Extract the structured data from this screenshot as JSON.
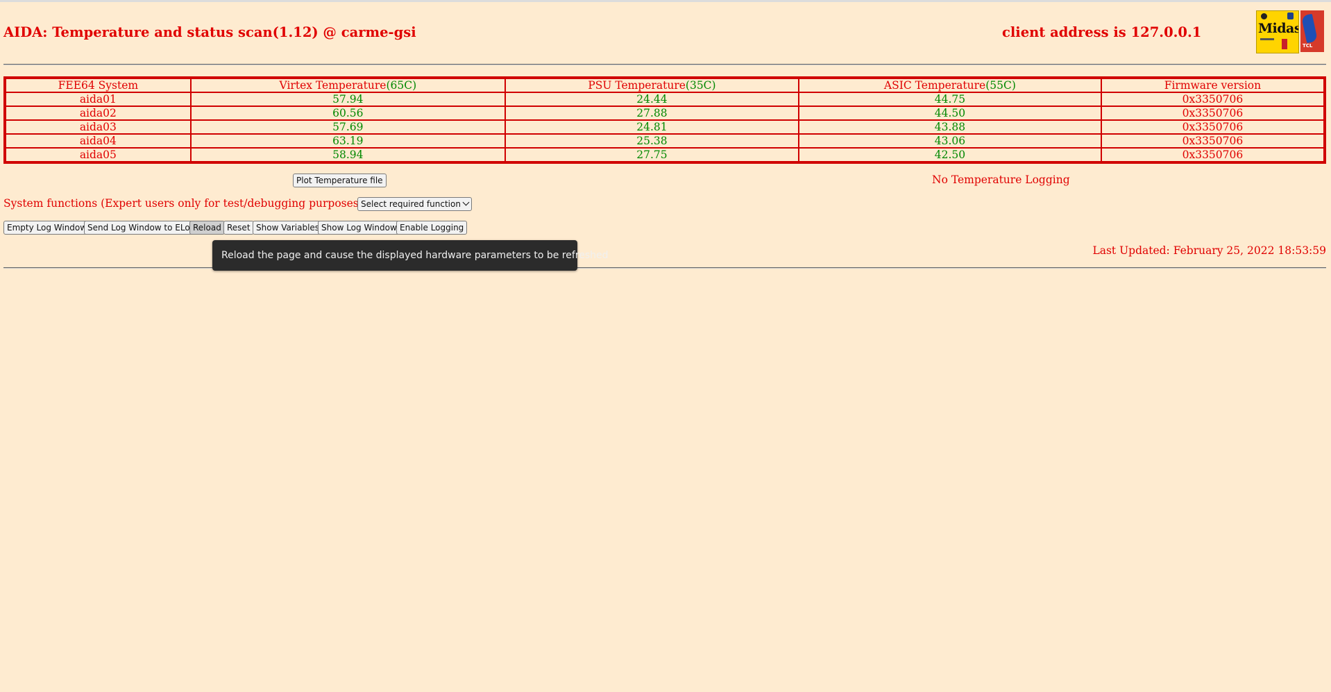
{
  "header": {
    "title": "AIDA: Temperature and status scan(1.12) @ carme-gsi",
    "client_address": "client address is 127.0.0.1",
    "logo_midas_text": "Midas",
    "logo_tcl_text": "TCL"
  },
  "table": {
    "headers": {
      "system": "FEE64 System",
      "virtex": "Virtex Temperature",
      "virtex_limit": "(65C)",
      "psu": "PSU Temperature",
      "psu_limit": "(35C)",
      "asic": "ASIC Temperature",
      "asic_limit": "(55C)",
      "firmware": "Firmware version"
    },
    "rows": [
      {
        "name": "aida01",
        "virtex": "57.94",
        "psu": "24.44",
        "asic": "44.75",
        "firmware": "0x3350706"
      },
      {
        "name": "aida02",
        "virtex": "60.56",
        "psu": "27.88",
        "asic": "44.50",
        "firmware": "0x3350706"
      },
      {
        "name": "aida03",
        "virtex": "57.69",
        "psu": "24.81",
        "asic": "43.88",
        "firmware": "0x3350706"
      },
      {
        "name": "aida04",
        "virtex": "63.19",
        "psu": "25.38",
        "asic": "43.06",
        "firmware": "0x3350706"
      },
      {
        "name": "aida05",
        "virtex": "58.94",
        "psu": "27.75",
        "asic": "42.50",
        "firmware": "0x3350706"
      }
    ]
  },
  "controls": {
    "plot_button": "Plot Temperature file",
    "no_logging": "No Temperature Logging",
    "system_functions_label": "System functions (Expert users only for test/debugging purposes!!!)",
    "select_value": "Select required function",
    "buttons": {
      "empty_log": "Empty Log Window",
      "send_log": "Send Log Window to ELog",
      "reload": "Reload",
      "reset": "Reset",
      "show_variables": "Show Variables",
      "show_log": "Show Log Window",
      "enable_logging": "Enable Logging"
    },
    "last_updated": "Last Updated: February 25, 2022 18:53:59",
    "tooltip": "Reload the page and cause the displayed hardware parameters to be refreshed"
  },
  "colors": {
    "background": "#feebd0",
    "accent_red": "#e00000",
    "value_green": "#008800"
  }
}
